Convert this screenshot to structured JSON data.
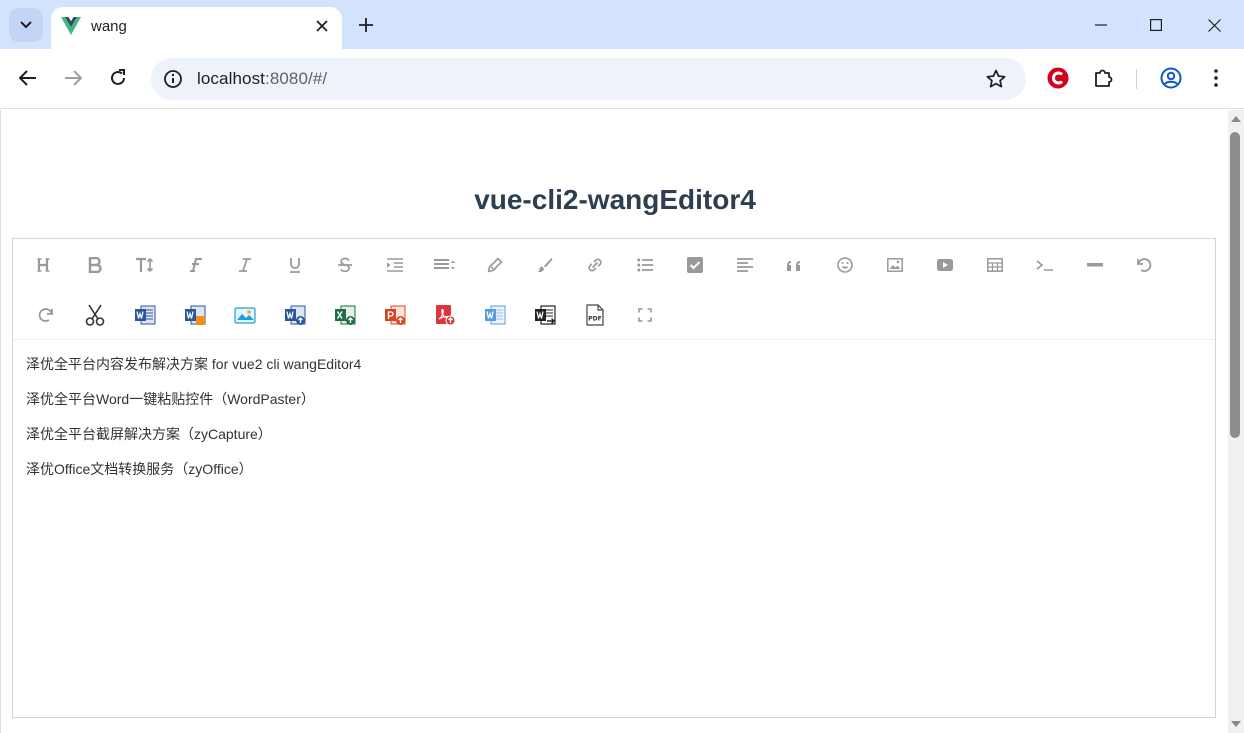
{
  "browser": {
    "tab": {
      "title": "wang"
    },
    "address": {
      "host": "localhost",
      "rest": ":8080/#/"
    },
    "colors": {
      "tabstrip": "#d3e3fd",
      "omnibox": "#eef2fa",
      "accent": "#0b57d0"
    }
  },
  "page": {
    "title": "vue-cli2-wangEditor4",
    "paragraphs": [
      "泽优全平台内容发布解决方案 for vue2 cli wangEditor4",
      "泽优全平台Word一键粘贴控件（WordPaster）",
      "泽优全平台截屏解决方案（zyCapture）",
      "泽优Office文档转换服务（zyOffice）"
    ]
  },
  "editor_toolbar": {
    "row1_icons": [
      "heading-icon",
      "bold-icon",
      "font-size-icon",
      "font-family-icon",
      "italic-icon",
      "underline-icon",
      "strikethrough-icon",
      "indent-icon",
      "line-height-icon",
      "font-color-icon",
      "background-color-icon",
      "link-icon",
      "bulleted-list-icon",
      "todo-icon",
      "justify-icon",
      "quote-icon",
      "emoticon-icon",
      "image-icon",
      "video-icon",
      "table-icon",
      "code-icon",
      "divider-icon",
      "undo-icon"
    ],
    "row2_icons": [
      "redo-icon",
      "cut-icon",
      "word-paste-icon",
      "word-import-icon",
      "screenshot-icon",
      "word-upload-icon",
      "excel-upload-icon",
      "ppt-upload-icon",
      "pdf-upload-icon",
      "wps-upload-icon",
      "word-export-icon",
      "pdf-export-icon",
      "fullscreen-icon"
    ],
    "icon_colors": {
      "default": "#999999",
      "word": "#2b579a",
      "excel": "#1e7145",
      "ppt": "#d24726",
      "pdf": "#d9363e"
    }
  }
}
